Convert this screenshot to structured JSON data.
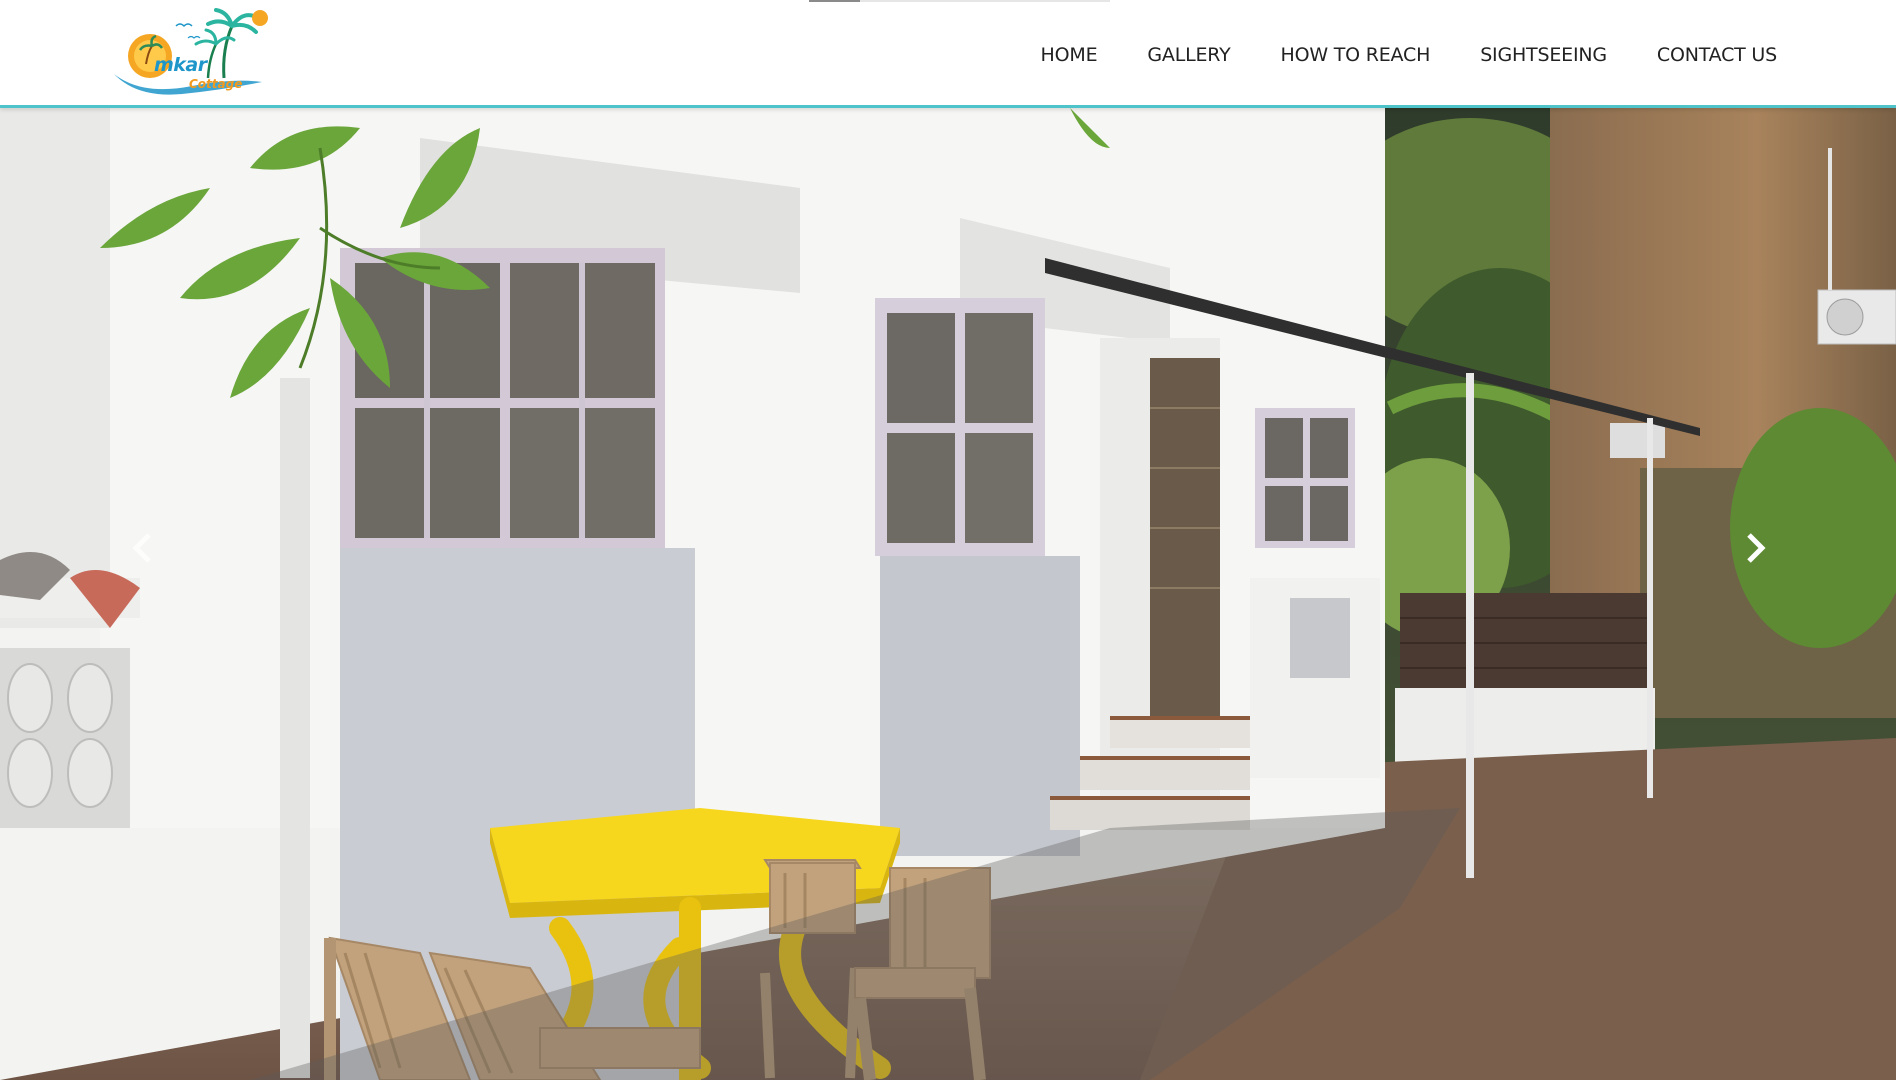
{
  "site": {
    "logo": {
      "main_text": "mkar",
      "sub_text": "Cottage",
      "icon": "sun-palm-logo-icon"
    }
  },
  "nav": {
    "items": [
      {
        "label": "HOME"
      },
      {
        "label": "GALLERY"
      },
      {
        "label": "HOW TO REACH"
      },
      {
        "label": "SIGHTSEEING"
      },
      {
        "label": "CONTACT US"
      }
    ]
  },
  "slider": {
    "progress_fraction": 0.17,
    "prev_icon": "chevron-left-icon",
    "next_icon": "chevron-right-icon",
    "image": "cottage-patio-photo"
  },
  "colors": {
    "accent": "#4ec3c9",
    "logo_blue": "#1f96c9",
    "logo_orange": "#f29a1f",
    "table_yellow": "#f7d61e",
    "chair_tan": "#c2a27c"
  }
}
